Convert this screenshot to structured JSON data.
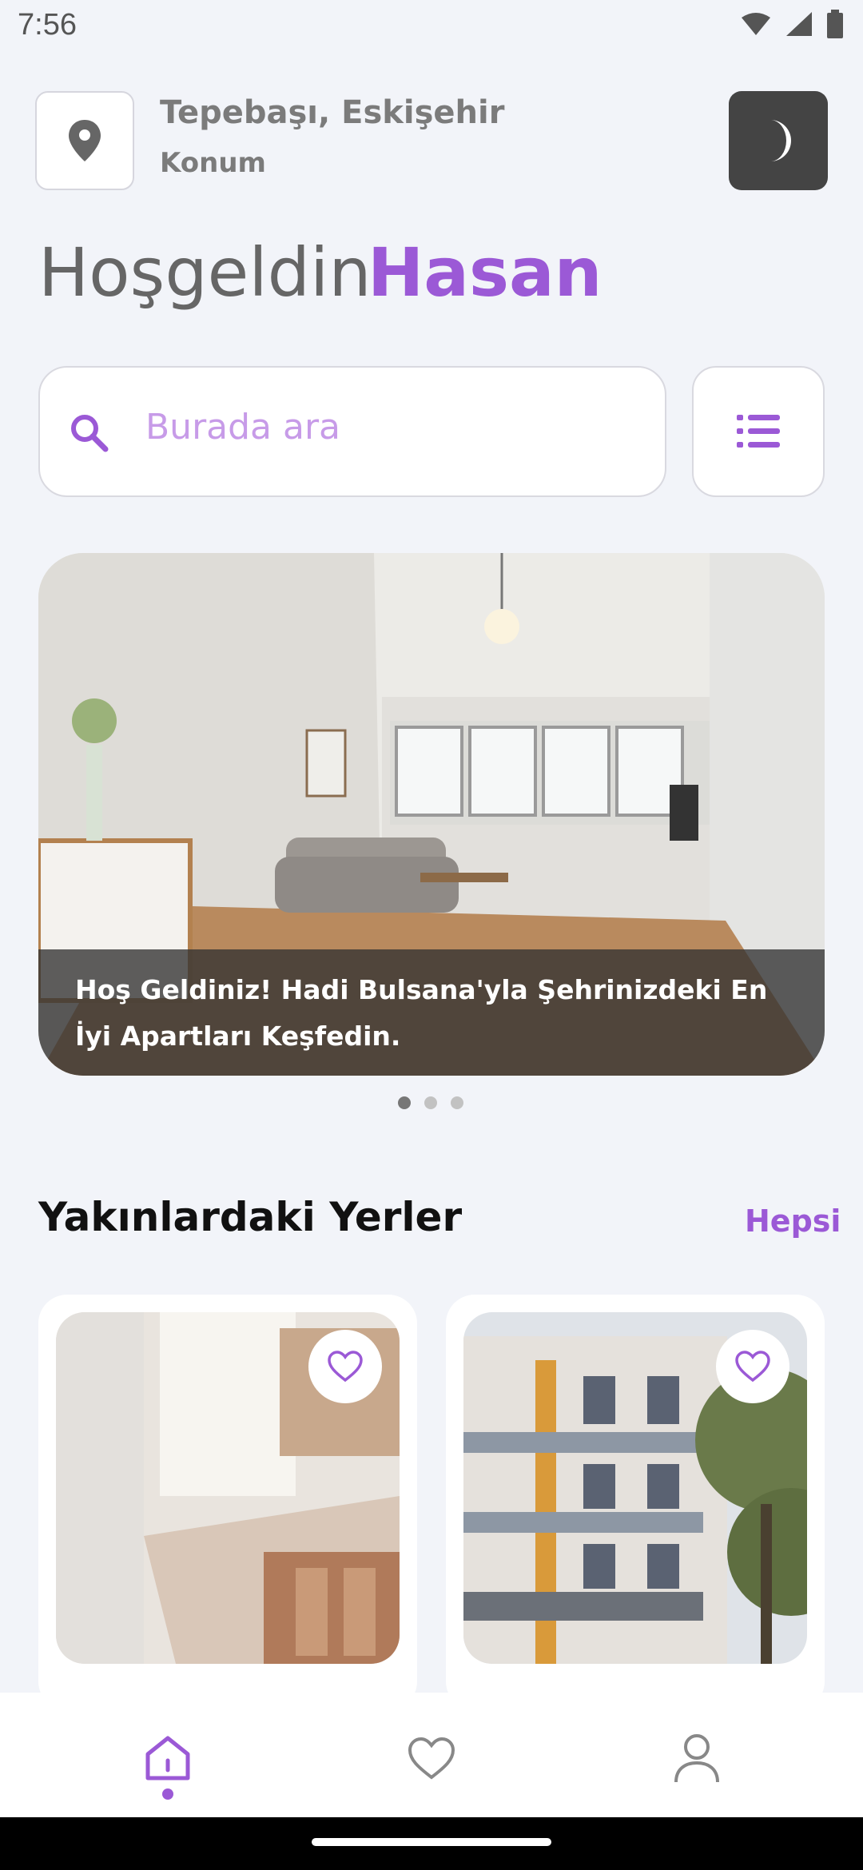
{
  "status": {
    "time": "7:56"
  },
  "header": {
    "location_city": "Tepebaşı, Eskişehir",
    "location_label": "Konum",
    "location_icon": "location-pin-icon",
    "theme_icon": "moon-icon"
  },
  "greeting": {
    "text": "Hoşgeldin",
    "name": "Hasan"
  },
  "search": {
    "placeholder": "Burada ara",
    "value": ""
  },
  "banner": {
    "caption": "Hoş Geldiniz! Hadi Bulsana'yla Şehrinizdeki En İyi Apartları Keşfedin.",
    "slides": 3,
    "active_slide": 1
  },
  "nearby": {
    "title": "Yakınlardaki Yerler",
    "see_all": "Hepsi"
  },
  "nav": {
    "items": [
      "home-icon",
      "heart-icon",
      "user-icon"
    ],
    "active": 0
  },
  "colors": {
    "accent": "#9b59d6",
    "dark_button": "#444444",
    "background": "#f2f4f9"
  }
}
